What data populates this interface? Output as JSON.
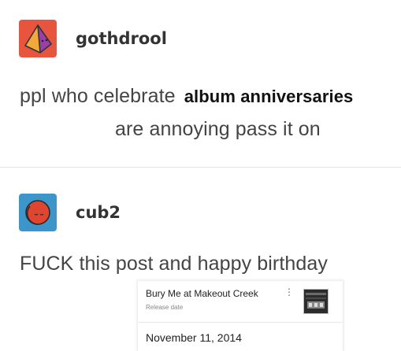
{
  "post1": {
    "username": "gothdrool",
    "avatar_icon": "pyramid-avatar-icon",
    "line1_prefix": "ppl who celebrate",
    "line1_highlight": "album anniversaries",
    "line2": "are annoying pass it on"
  },
  "post2": {
    "username": "cub2",
    "avatar_icon": "sleeping-moon-avatar-icon",
    "text": "FUCK this post and happy birthday"
  },
  "embed": {
    "title": "Bury Me at Makeout Creek",
    "subtitle": "Release date",
    "menu_icon": "more-vert-icon",
    "date": "November 11, 2014"
  },
  "colors": {
    "avatar1_bg": "#e8553f",
    "avatar2_bg": "#3d96c9",
    "avatar2_face": "#e0462f",
    "divider": "#e2e2e2"
  }
}
